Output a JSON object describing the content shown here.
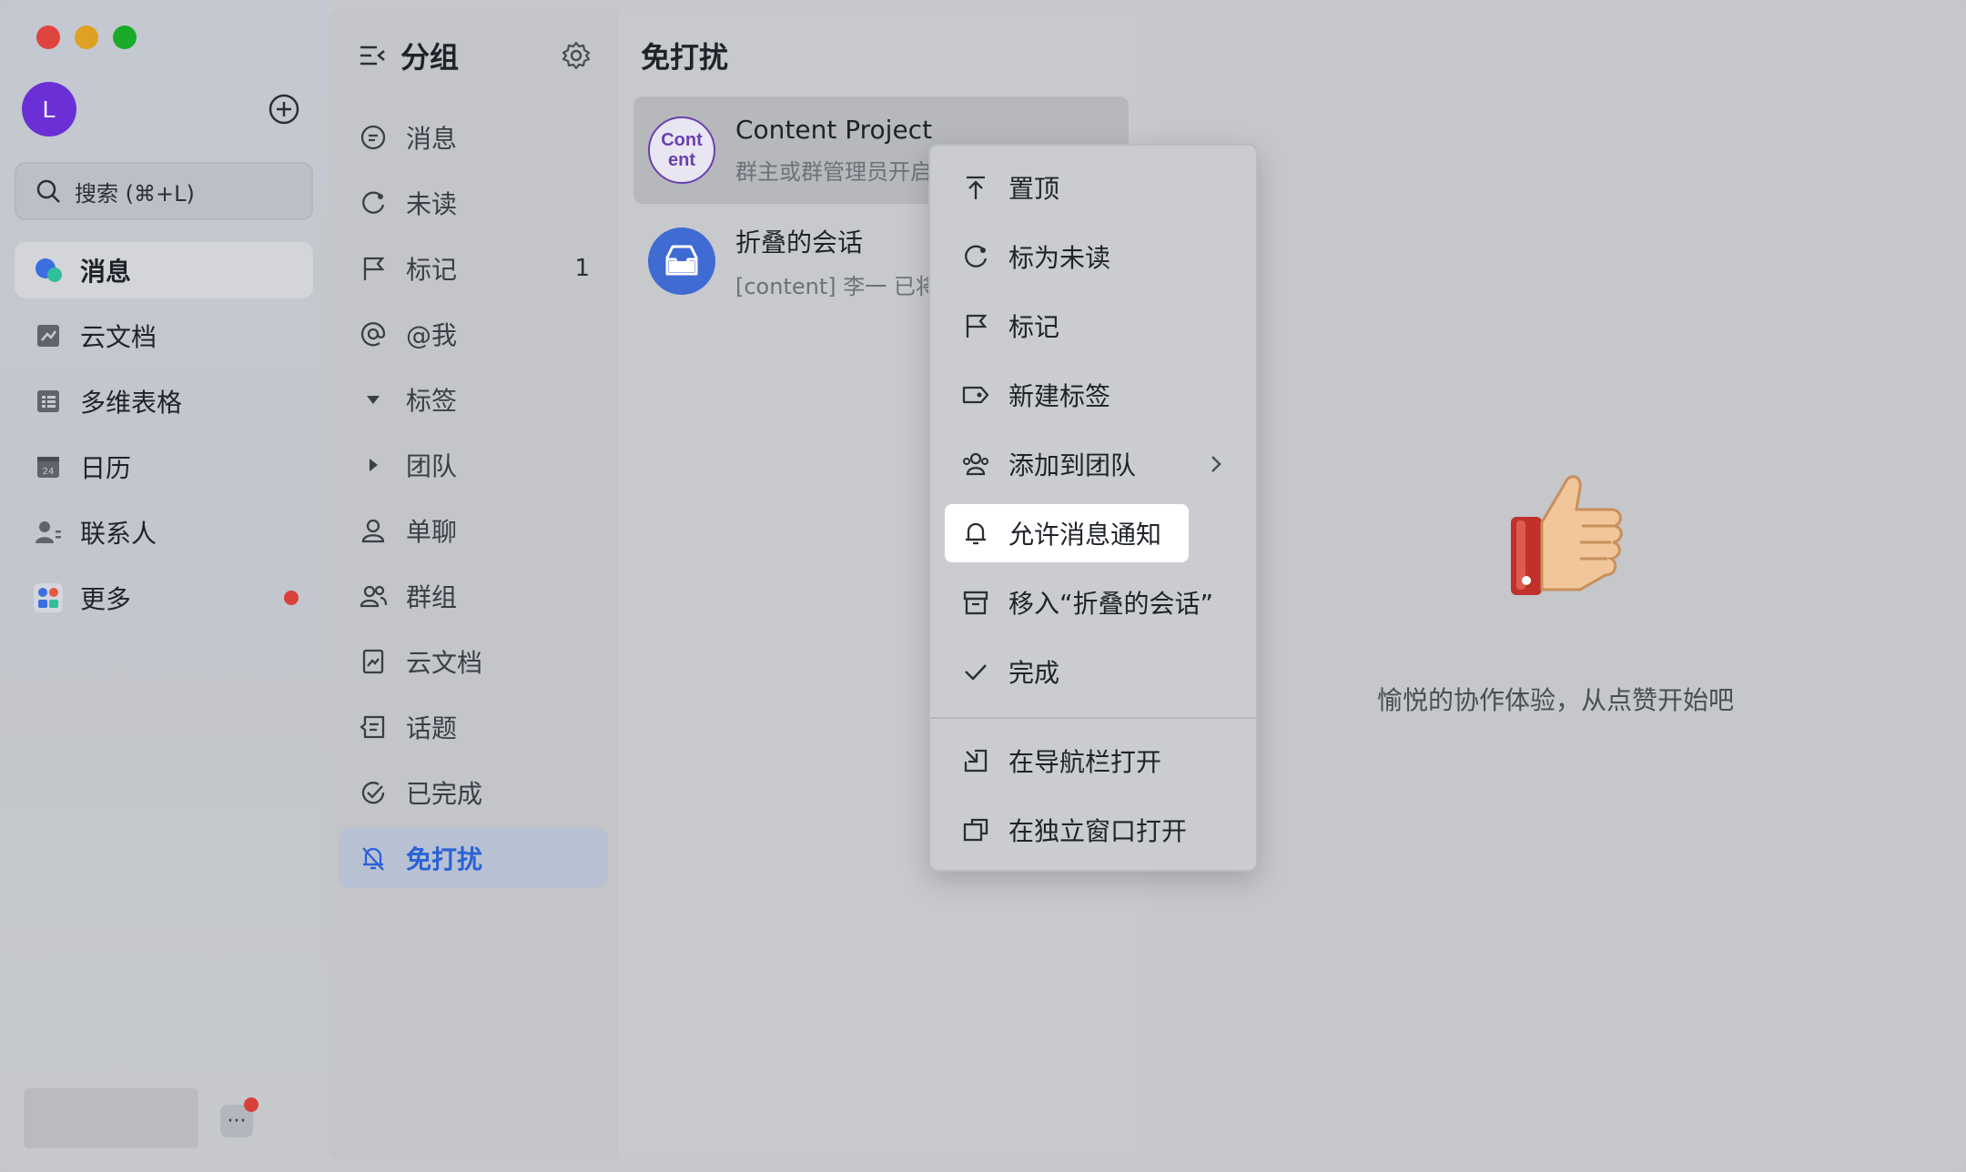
{
  "nav": {
    "avatar_letter": "L",
    "search_placeholder": "搜索 (⌘+L)",
    "items": [
      {
        "label": "消息"
      },
      {
        "label": "云文档"
      },
      {
        "label": "多维表格"
      },
      {
        "label": "日历"
      },
      {
        "label": "联系人"
      },
      {
        "label": "更多"
      }
    ],
    "more_dots": "···"
  },
  "groups": {
    "title": "分组",
    "items": [
      {
        "label": "消息"
      },
      {
        "label": "未读"
      },
      {
        "label": "标记",
        "count": "1"
      },
      {
        "label": "@我"
      },
      {
        "label": "标签"
      },
      {
        "label": "团队"
      },
      {
        "label": "单聊"
      },
      {
        "label": "群组"
      },
      {
        "label": "云文档"
      },
      {
        "label": "话题"
      },
      {
        "label": "已完成"
      },
      {
        "label": "免打扰"
      }
    ]
  },
  "conversations": {
    "title": "免打扰",
    "items": [
      {
        "avatar_text_1": "Cont",
        "avatar_text_2": "ent",
        "name": "Content Project",
        "preview": "群主或群管理员开启"
      },
      {
        "name": "折叠的会话",
        "preview": "[content] 李一 已将"
      }
    ]
  },
  "detail": {
    "message": "愉悦的协作体验，从点赞开始吧"
  },
  "context_menu": {
    "items": [
      {
        "label": "置顶"
      },
      {
        "label": "标为未读"
      },
      {
        "label": "标记"
      },
      {
        "label": "新建标签"
      },
      {
        "label": "添加到团队"
      },
      {
        "label": "允许消息通知"
      },
      {
        "label": "移入“折叠的会话”"
      },
      {
        "label": "完成"
      },
      {
        "label": "在导航栏打开"
      },
      {
        "label": "在独立窗口打开"
      }
    ]
  },
  "colors": {
    "accent": "#2a62d6",
    "alert_red": "#d8413a",
    "avatar_purple": "#6b2fd6"
  }
}
